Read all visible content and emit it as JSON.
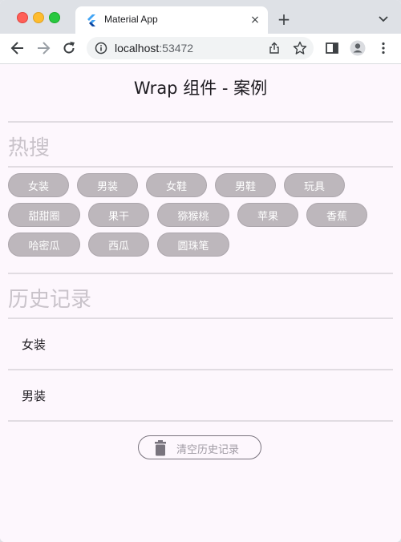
{
  "browser": {
    "tab_title": "Material App",
    "url_host": "localhost",
    "url_port": ":53472",
    "new_tab_label": "+",
    "close_tab_label": "×"
  },
  "app": {
    "title": "Wrap 组件 - 案例"
  },
  "hot_search": {
    "heading": "热搜",
    "rows": [
      [
        "女装",
        "男装",
        "女鞋",
        "男鞋",
        "玩具"
      ],
      [
        "甜甜圈",
        "果干",
        "猕猴桃",
        "苹果",
        "香蕉"
      ],
      [
        "哈密瓜",
        "西瓜",
        "圆珠笔"
      ]
    ]
  },
  "history": {
    "heading": "历史记录",
    "items": [
      "女装",
      "男装"
    ],
    "clear_button_label": "清空历史记录"
  },
  "colors": {
    "chip_background": "#bdb7bc",
    "page_background": "#fdf7fd",
    "divider": "#e1dce2"
  },
  "icons": {
    "favicon": "flutter-icon",
    "back": "arrow-left-icon",
    "forward": "arrow-right-icon",
    "reload": "reload-icon",
    "info": "info-icon",
    "share": "share-icon",
    "bookmark": "star-icon",
    "sidepanel": "side-panel-icon",
    "profile": "avatar-icon",
    "menu": "kebab-menu-icon",
    "clear": "trash-icon"
  }
}
